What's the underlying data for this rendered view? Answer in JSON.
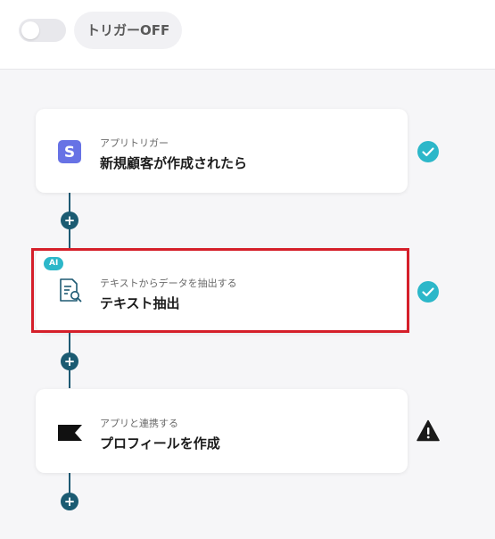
{
  "trigger": {
    "toggle_state": "off",
    "label": "トリガーOFF"
  },
  "flow": {
    "steps": [
      {
        "subtitle": "アプリトリガー",
        "title": "新規顧客が作成されたら",
        "icon": "stripe-s-icon",
        "status": "complete",
        "status_icon": "check-circle-icon"
      },
      {
        "badge": "AI",
        "subtitle": "テキストからデータを抽出する",
        "title": "テキスト抽出",
        "icon": "document-search-icon",
        "status": "complete",
        "status_icon": "check-circle-icon",
        "highlighted": true
      },
      {
        "subtitle": "アプリと連携する",
        "title": "プロフィールを作成",
        "icon": "black-flag-icon",
        "status": "warning",
        "status_icon": "warning-triangle-icon"
      }
    ],
    "add_step_symbol": "+"
  },
  "colors": {
    "accent_teal": "#2cb7c9",
    "connector": "#1e5a73",
    "highlight_red": "#d51f2a",
    "stripe_purple": "#6772e5"
  }
}
